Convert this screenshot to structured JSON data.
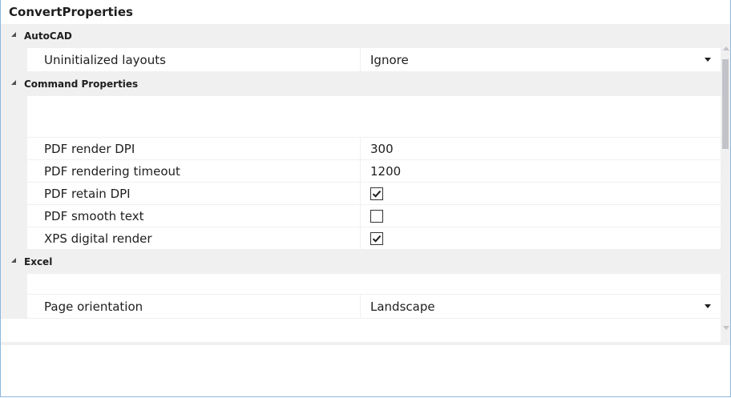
{
  "title": "ConvertProperties",
  "categories": {
    "autocad": {
      "label": "AutoCAD",
      "rows": {
        "uninitialized_layouts": {
          "name": "Uninitialized layouts",
          "value": "Ignore"
        }
      }
    },
    "command_properties": {
      "label": "Command Properties",
      "rows": {
        "pdf_render_dpi": {
          "name": "PDF render DPI",
          "value": "300"
        },
        "pdf_rendering_timeout": {
          "name": "PDF rendering timeout",
          "value": "1200"
        },
        "pdf_retain_dpi": {
          "name": "PDF retain DPI",
          "checked": true
        },
        "pdf_smooth_text": {
          "name": "PDF smooth text",
          "checked": false
        },
        "xps_digital_render": {
          "name": "XPS digital render",
          "checked": true
        }
      }
    },
    "excel": {
      "label": "Excel",
      "rows": {
        "page_orientation": {
          "name": "Page orientation",
          "value": "Landscape"
        }
      }
    }
  },
  "icons": {
    "expander": "triangle-expanded-icon",
    "dropdown": "chevron-down-icon",
    "checkmark": "checkmark-icon"
  },
  "colors": {
    "frame_border": "#8cb8e0",
    "category_background": "#f0f0f0",
    "scrollbar_thumb": "#c2c3c9"
  }
}
